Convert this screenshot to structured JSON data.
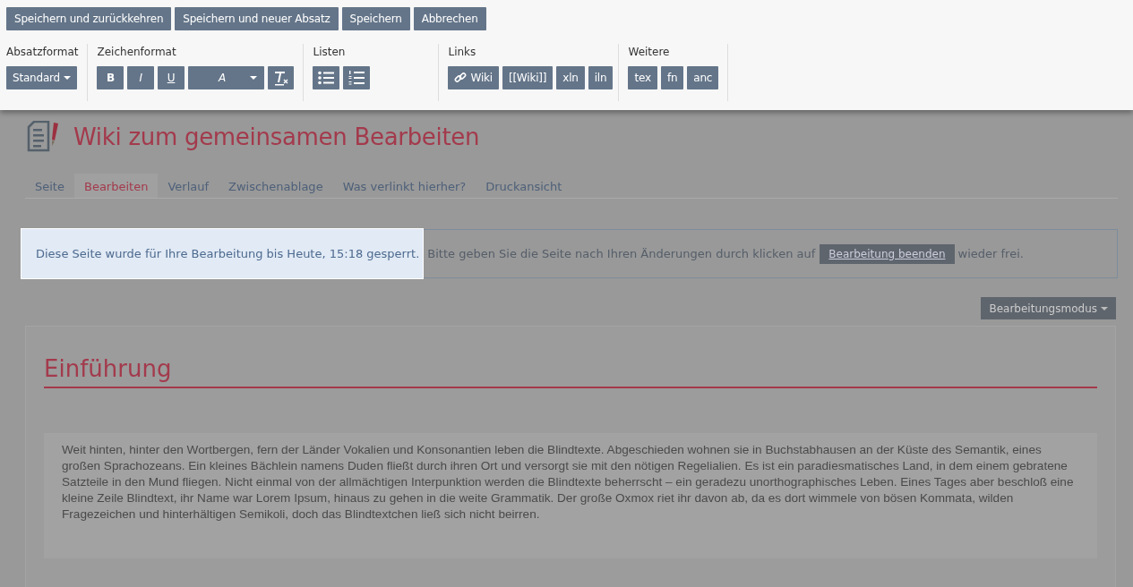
{
  "actions": [
    "Speichern und zurückkehren",
    "Speichern und neuer Absatz",
    "Speichern",
    "Abbrechen"
  ],
  "toolbar": [
    {
      "label": "Absatzformat",
      "controls": [
        {
          "kind": "dropdown",
          "text": "Standard"
        }
      ]
    },
    {
      "label": "Zeichenformat",
      "controls": [
        {
          "kind": "bold",
          "text": "B"
        },
        {
          "kind": "italic",
          "text": "I"
        },
        {
          "kind": "underline",
          "text": "U"
        },
        {
          "kind": "font",
          "text": "A"
        },
        {
          "kind": "clear"
        }
      ]
    },
    {
      "label": "Listen",
      "controls": [
        {
          "kind": "bullets"
        },
        {
          "kind": "numbers"
        }
      ]
    },
    {
      "label": "Links",
      "controls": [
        {
          "kind": "link",
          "text": "Wiki"
        },
        {
          "kind": "text",
          "text": "[[Wiki]]"
        },
        {
          "kind": "text",
          "text": "xln"
        },
        {
          "kind": "text",
          "text": "iln"
        }
      ]
    },
    {
      "label": "Weitere",
      "controls": [
        {
          "kind": "text",
          "text": "tex"
        },
        {
          "kind": "text",
          "text": "fn"
        },
        {
          "kind": "text",
          "text": "anc"
        }
      ]
    }
  ],
  "page_title": "Wiki zum gemeinsamen Bearbeiten",
  "tabs": [
    {
      "label": "Seite",
      "selected": false
    },
    {
      "label": "Bearbeiten",
      "selected": true
    },
    {
      "label": "Verlauf",
      "selected": false
    },
    {
      "label": "Zwischenablage",
      "selected": false
    },
    {
      "label": "Was verlinkt hierher?",
      "selected": false
    },
    {
      "label": "Druckansicht",
      "selected": false
    }
  ],
  "notice": {
    "highlighted": "Diese Seite wurde für Ihre Bearbeitung bis Heute, 15:18 gesperrt.",
    "text": "Bitte geben Sie die Seite nach Ihren Änderungen durch klicken auf",
    "button": "Bearbeitung beenden",
    "text_after": "wieder frei."
  },
  "mode_button": "Bearbeitungsmodus",
  "heading": "Einführung",
  "paragraph": "Weit hinten, hinter den Wortbergen, fern der Länder Vokalien und Konsonantien leben die Blindtexte. Abgeschieden wohnen sie in Buchstabhausen an der Küste des Semantik, eines großen Sprachozeans. Ein kleines Bächlein namens Duden fließt durch ihren Ort und versorgt sie mit den nötigen Regelialien. Es ist ein paradiesmatisches Land, in dem einem gebratene Satzteile in den Mund fliegen. Nicht einmal von der allmächtigen Interpunktion werden die Blindtexte beherrscht – ein geradezu unorthographisches Leben. Eines Tages aber beschloß eine kleine Zeile Blindtext, ihr Name war Lorem Ipsum, hinaus zu gehen in die weite Grammatik. Der große Oxmox riet ihr davon ab, da es dort wimmele von bösen Kommata, wilden Fragezeichen und hinterhältigen Semikoli, doch das Blindtextchen ließ sich nicht beirren."
}
